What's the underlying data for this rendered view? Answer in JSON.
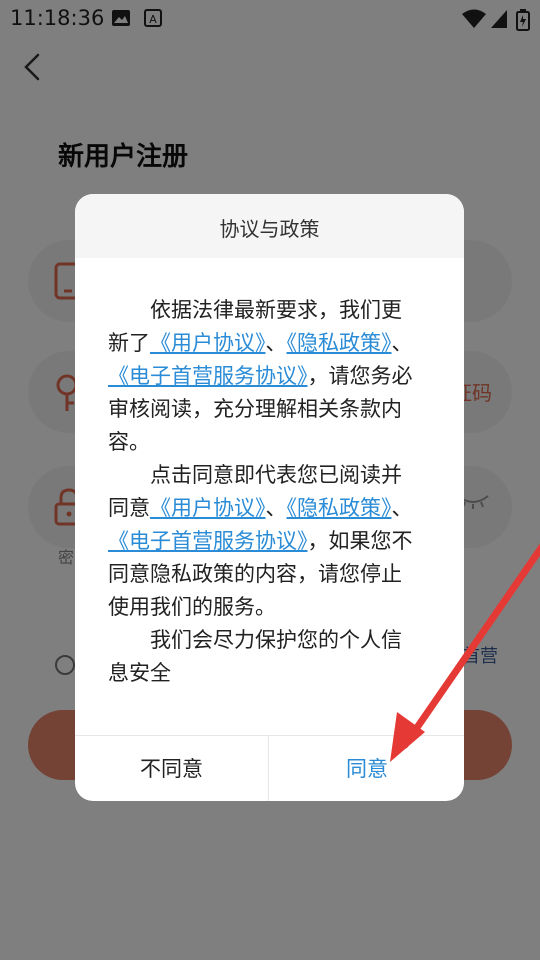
{
  "status_bar": {
    "time": "11:18:36"
  },
  "page": {
    "title": "新用户注册",
    "code_button_label": "证码",
    "password_label": "密",
    "agreement_tail": "首营"
  },
  "dialog": {
    "title": "协议与政策",
    "paragraphs": [
      {
        "t1": "依据法律最新要求，我们更新了",
        "l1": "《用户协议》",
        "t2": "、",
        "l2": "《隐私政策》",
        "t3": "、",
        "l3": "《电子首营服务协议》",
        "t4": "，请您务必审核阅读，充分理解相关条款内容。"
      },
      {
        "t1": "点击同意即代表您已阅读并同意",
        "l1": "《用户协议》",
        "t2": "、",
        "l2": "《隐私政策》",
        "t3": "、",
        "l3": "《电子首营服务协议》",
        "t4": "，如果您不同意隐私政策的内容，请您停止使用我们的服务。"
      },
      {
        "t1": "我们会尽力保护您的个人信息安全"
      }
    ],
    "disagree_label": "不同意",
    "agree_label": "同意"
  },
  "colors": {
    "link": "#2a8bd6",
    "accent": "#e9876d",
    "annotation_arrow": "#e53935"
  }
}
